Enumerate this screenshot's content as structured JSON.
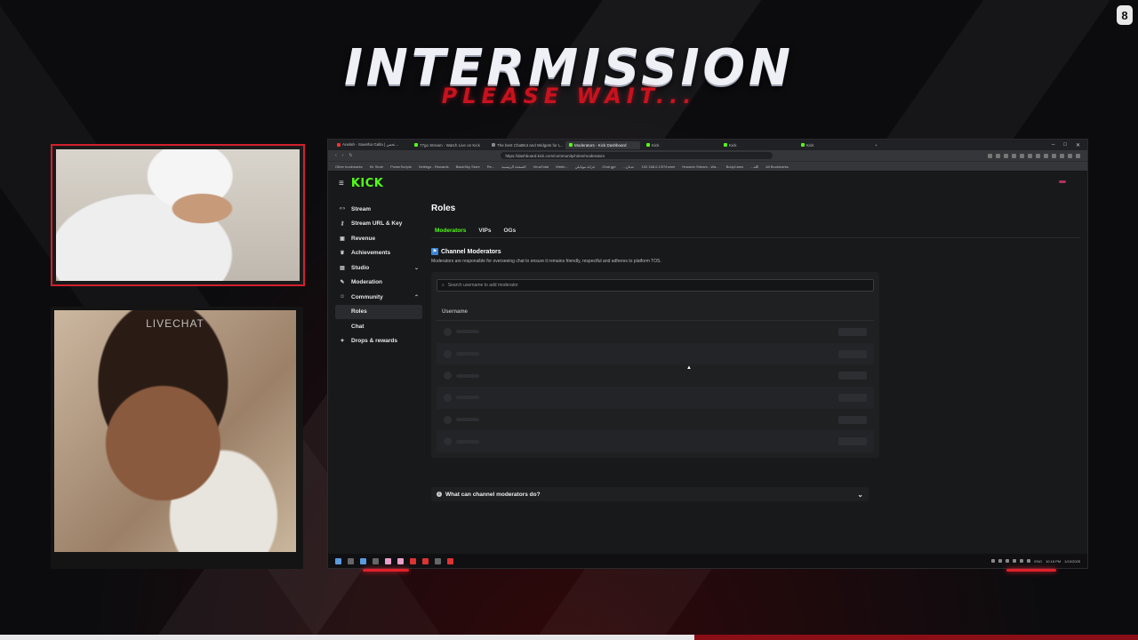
{
  "overlay": {
    "title": "INTERMISSION",
    "subtitle": "PLEASE WAIT...",
    "livechat_label": "LIVECHAT",
    "accent_color": "#c8121e",
    "corner_badge_icon": "streamer-logo-icon",
    "progress_fraction": 0.61
  },
  "browser": {
    "tabs": [
      {
        "label": "Anelah - Sawsha Galla | نحس...",
        "icon": "red"
      },
      {
        "label": "77go Stream - Watch Live on Kick",
        "icon": "kick"
      },
      {
        "label": "The best ChatBot and Widgets for L...",
        "icon": "grey"
      },
      {
        "label": "Moderators - Kick Dashboard",
        "icon": "kick",
        "active": true
      },
      {
        "label": "Kick",
        "icon": "kick"
      },
      {
        "label": "Kick",
        "icon": "kick"
      },
      {
        "label": "Kick",
        "icon": "kick"
      }
    ],
    "url": "https://dashboard.kick.com/community/roles/moderators",
    "bookmarks": [
      "Other bookmarks",
      "Kir Store",
      "PowerScripts",
      "Settings - Rewards",
      "BlackSky Store",
      "Re...",
      "الصفحة الرئيسية",
      "VirusTotal",
      "Webb...",
      "خزانة موبايلي",
      "Chat gpt",
      "...عدنان",
      "192.168.0.1/97/home",
      "Hussein Stream - Wa...",
      "BodyCams",
      "...الله",
      "All Bookmarks"
    ]
  },
  "kick": {
    "logo": "KICK",
    "sidebar": [
      {
        "label": "Stream",
        "icon": "broadcast-icon",
        "glyph": "‹·›"
      },
      {
        "label": "Stream URL & Key",
        "icon": "key-icon",
        "glyph": "⚷"
      },
      {
        "label": "Revenue",
        "icon": "revenue-icon",
        "glyph": "▣"
      },
      {
        "label": "Achievements",
        "icon": "trophy-icon",
        "glyph": "♛"
      },
      {
        "label": "Studio",
        "icon": "studio-icon",
        "glyph": "▤",
        "chevron": "⌄"
      },
      {
        "label": "Moderation",
        "icon": "hammer-icon",
        "glyph": "✎"
      },
      {
        "label": "Community",
        "icon": "community-icon",
        "glyph": "☺",
        "chevron": "⌃"
      },
      {
        "label": "Roles",
        "sub": true,
        "active": true
      },
      {
        "label": "Chat",
        "sub": true
      },
      {
        "label": "Drops & rewards",
        "icon": "gift-icon",
        "glyph": "✦"
      }
    ],
    "page_title": "Roles",
    "tabs": [
      "Moderators",
      "VIPs",
      "OGs"
    ],
    "active_tab": "Moderators",
    "panel_title": "Channel Moderators",
    "panel_description": "Moderators are responsible for overseeing chat to ensure it remains friendly, respectful and adheres to platform TOS.",
    "search_placeholder": "Search username to add moderator",
    "column_header": "Username",
    "loading_rows": 6,
    "faq_label": "What can channel moderators do?",
    "brand_color": "#53fc18"
  },
  "taskbar": {
    "time": "10:18 PM",
    "date": "1/10/2025",
    "lang": "ENG"
  }
}
